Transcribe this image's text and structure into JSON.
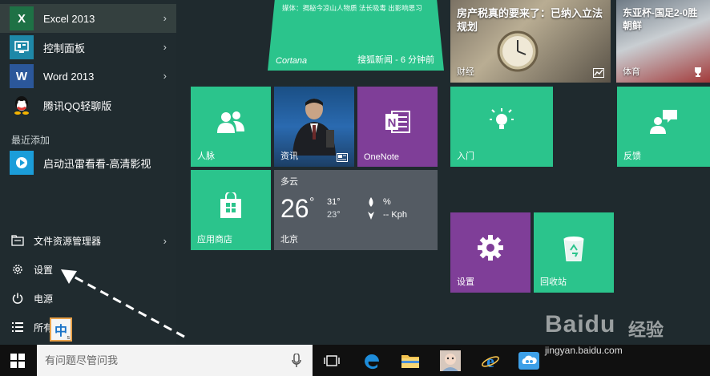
{
  "start_menu": {
    "apps": [
      {
        "label": "Excel 2013",
        "icon": "excel-icon",
        "color": "#1e7145",
        "letter": "X",
        "has_arrow": true
      },
      {
        "label": "控制面板",
        "icon": "control-panel-icon",
        "color": "#1e88a8",
        "has_arrow": true
      },
      {
        "label": "Word 2013",
        "icon": "word-icon",
        "color": "#2b579a",
        "letter": "W",
        "has_arrow": true
      },
      {
        "label": "腾讯QQ轻聊版",
        "icon": "qq-icon",
        "color": "#1f2a2e",
        "has_arrow": false
      }
    ],
    "recent_section": "最近添加",
    "recent_app": {
      "label": "启动迅雷看看-高清影视",
      "icon": "xunlei-icon",
      "color": "#1b9dd9"
    },
    "system": [
      {
        "label": "文件资源管理器",
        "icon": "file-explorer-icon",
        "has_arrow": true
      },
      {
        "label": "设置",
        "icon": "settings-gear-icon"
      },
      {
        "label": "电源",
        "icon": "power-icon"
      },
      {
        "label": "所有",
        "icon": "all-apps-icon"
      }
    ]
  },
  "tiles": {
    "cortana": {
      "news": "媒体：揭秘今凉山人物质 法长吸毒 出影响思习",
      "name": "Cortana",
      "source": "搜狐新闻 - 6 分钟前"
    },
    "news_main": {
      "headline": "房产税真的要来了：已纳入立法规划",
      "category": "财经"
    },
    "news_sports": {
      "headline": "东亚杯-国足2-0胜朝鲜",
      "category": "体育"
    },
    "people": {
      "label": "人脉"
    },
    "news_photo": {
      "label": "资讯"
    },
    "onenote": {
      "label": "OneNote"
    },
    "getstarted": {
      "label": "入门"
    },
    "feedback": {
      "label": "反馈"
    },
    "store": {
      "label": "应用商店"
    },
    "weather": {
      "condition": "多云",
      "temp": "26",
      "unit": "°",
      "high": "31°",
      "low": "23°",
      "humidity": "%",
      "wind": "-- Kph",
      "city": "北京"
    },
    "settings": {
      "label": "设置"
    },
    "recycle": {
      "label": "回收站"
    }
  },
  "taskbar": {
    "search_placeholder": "有问题尽管问我",
    "ime": "中",
    "ime_sub": "s"
  },
  "watermark": {
    "logo": "Baidu",
    "cn": "经验",
    "url": "jingyan.baidu.com"
  },
  "colors": {
    "green": "#2bc48c",
    "purple": "#7f3e98",
    "gray": "#545b63",
    "taskbar": "#101010"
  }
}
